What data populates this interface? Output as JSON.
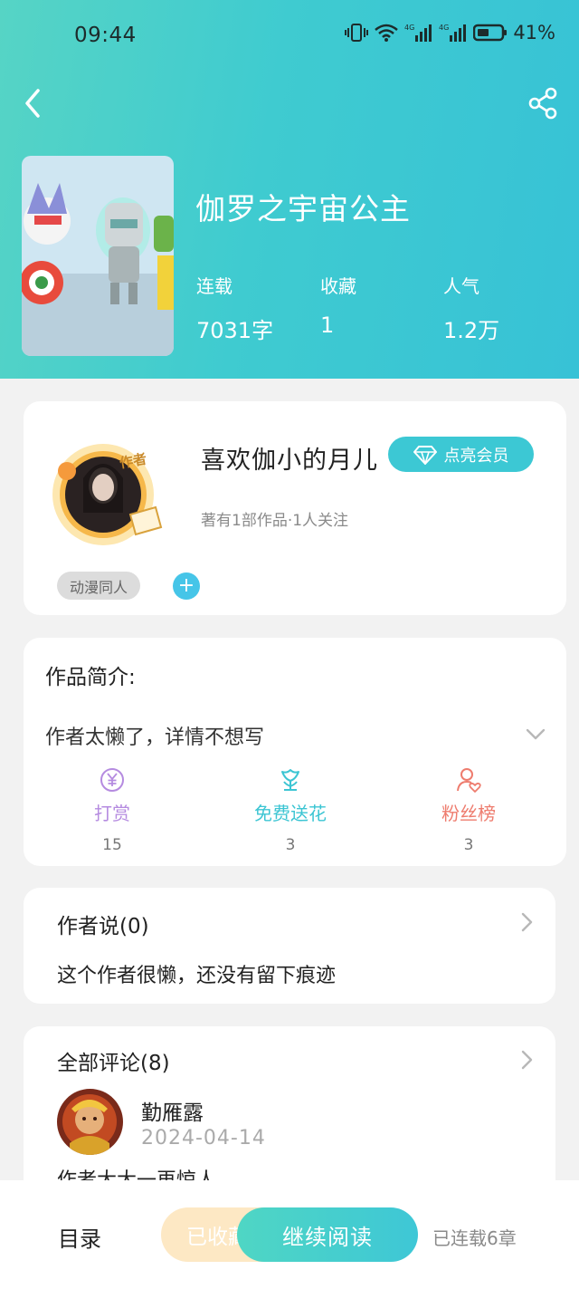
{
  "status_bar": {
    "time": "09:44",
    "battery": "41%",
    "signal_label": "4G"
  },
  "book": {
    "title": "伽罗之宇宙公主",
    "stats": [
      {
        "label": "连载",
        "value": "7031字"
      },
      {
        "label": "收藏",
        "value": "1"
      },
      {
        "label": "人气",
        "value": "1.2万"
      }
    ]
  },
  "author": {
    "name": "喜欢伽小的月儿",
    "badge": "作者",
    "vip_label": "点亮会员",
    "meta": "著有1部作品·1人关注",
    "tag": "动漫同人",
    "add_tag": "+"
  },
  "intro": {
    "heading": "作品简介:",
    "text": "作者太懒了，详情不想写",
    "actions": [
      {
        "label": "打赏",
        "count": "15",
        "color": "#b58be0"
      },
      {
        "label": "免费送花",
        "count": "3",
        "color": "#3cc5d3"
      },
      {
        "label": "粉丝榜",
        "count": "3",
        "color": "#ee7c6e"
      }
    ]
  },
  "author_says": {
    "heading": "作者说(0)",
    "text": "这个作者很懒，还没有留下痕迹"
  },
  "comments": {
    "heading": "全部评论(8)",
    "items": [
      {
        "name": "勤雁露",
        "date": "2024-04-14",
        "text": "作者大大一再惊人"
      }
    ]
  },
  "bottom_bar": {
    "toc": "目录",
    "collected": "已收藏",
    "continue": "继续阅读",
    "chapters": "已连载6章"
  }
}
